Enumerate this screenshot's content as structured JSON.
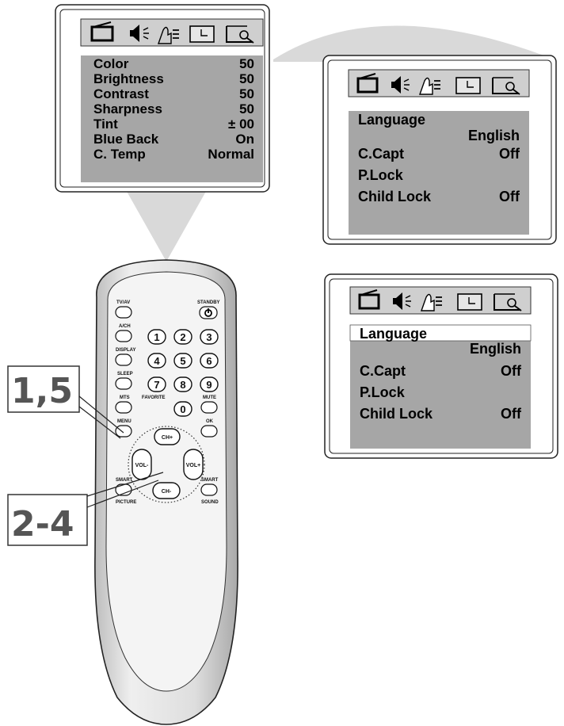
{
  "menu_picture": {
    "icons": [
      "picture-tv-icon",
      "speaker-sound-icon",
      "hand-features-icon",
      "clock-timer-icon",
      "magnifier-install-icon"
    ],
    "rows": [
      {
        "label": "Color",
        "value": "50"
      },
      {
        "label": "Brightness",
        "value": "50"
      },
      {
        "label": "Contrast",
        "value": "50"
      },
      {
        "label": "Sharpness",
        "value": "50"
      },
      {
        "label": "Tint",
        "value": "± 00"
      },
      {
        "label": "Blue Back",
        "value": "On"
      },
      {
        "label": "C. Temp",
        "value": "Normal"
      }
    ]
  },
  "menu_features_a": {
    "language_label": "Language",
    "language_value": "English",
    "rows": [
      {
        "label": "C.Capt",
        "value": "Off"
      },
      {
        "label": "P.Lock",
        "value": ""
      },
      {
        "label": "Child Lock",
        "value": "Off"
      }
    ]
  },
  "menu_features_b": {
    "language_label": "Language",
    "language_value": "English",
    "rows": [
      {
        "label": "C.Capt",
        "value": "Off"
      },
      {
        "label": "P.Lock",
        "value": ""
      },
      {
        "label": "Child Lock",
        "value": "Off"
      }
    ]
  },
  "remote": {
    "tvav": "TV/AV",
    "standby": "STANDBY",
    "ach": "A/CH",
    "display": "DISPLAY",
    "sleep": "SLEEP",
    "mts": "MTS",
    "favorite": "FAVORITE",
    "mute": "MUTE",
    "menu": "MENU",
    "ok": "OK",
    "ch_up": "CH+",
    "ch_down": "CH-",
    "vol_down": "VOL-",
    "vol_up": "VOL+",
    "smart_left": "SMART",
    "picture": "PICTURE",
    "smart_right": "SMART",
    "sound": "SOUND",
    "digits": [
      "1",
      "2",
      "3",
      "4",
      "5",
      "6",
      "7",
      "8",
      "9",
      "0"
    ]
  },
  "callouts": {
    "step_a": "1,5",
    "step_b": "2-4"
  },
  "colors": {
    "screen_bg": "#a6a6a6",
    "icon_bar": "#cfcfcf",
    "beam": "#d9d9d9",
    "remote_body": "#dcdcdc"
  }
}
